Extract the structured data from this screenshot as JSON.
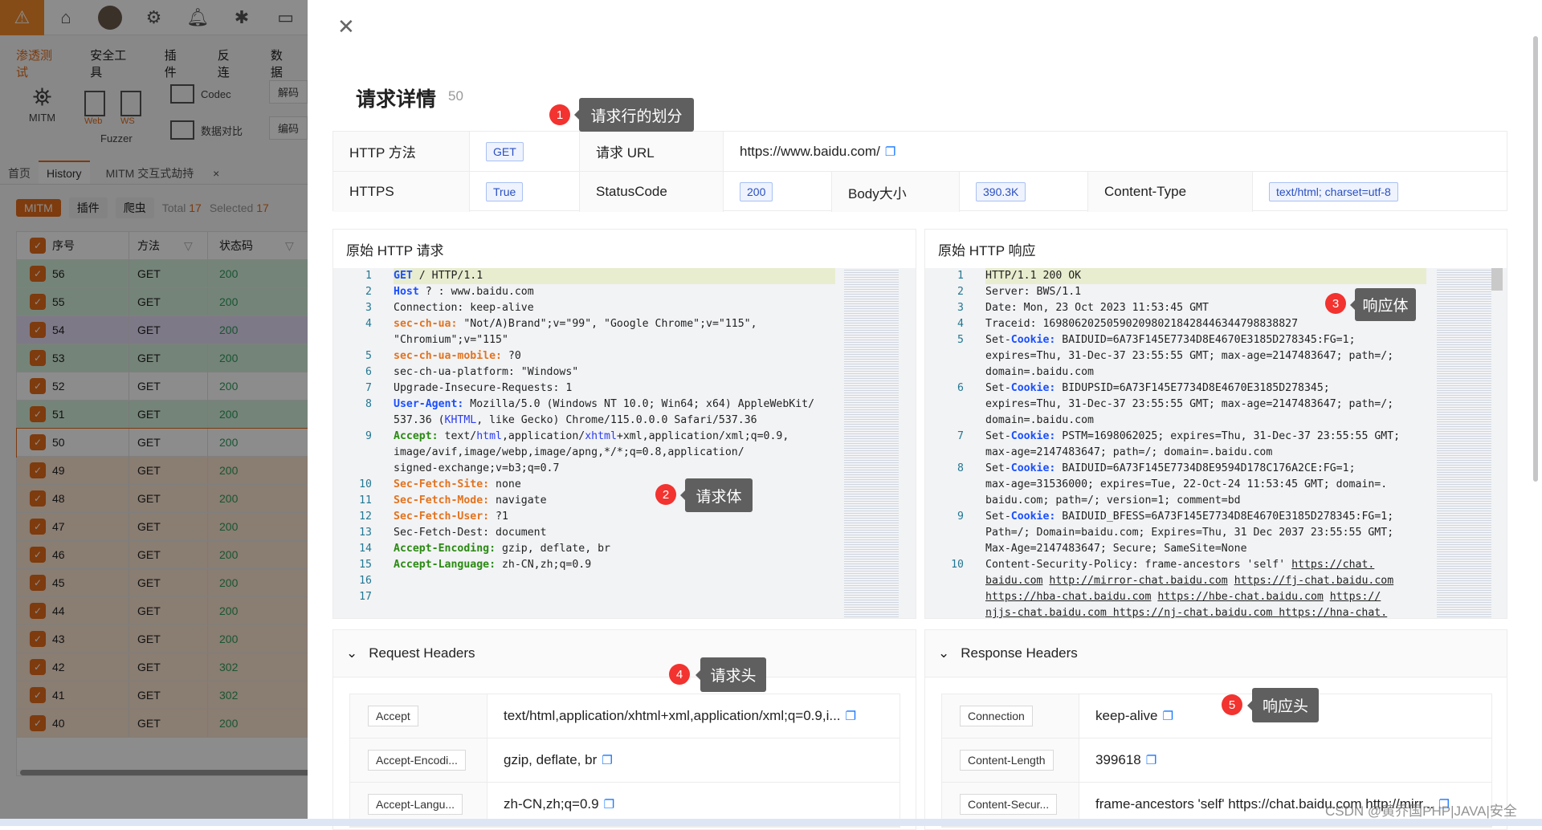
{
  "app": {
    "topbar_icons": [
      "warning-icon",
      "home-icon",
      "avatar",
      "gear-icon",
      "bell-icon",
      "bug-icon",
      "terminal-icon"
    ],
    "menu": [
      "渗透测试",
      "安全工具",
      "插件",
      "反连",
      "数据"
    ],
    "tools": {
      "mitm": "MITM",
      "fuzzer": "Fuzzer",
      "web": "Web",
      "ws": "WS",
      "codec": "Codec",
      "compare": "数据对比",
      "decode": "解码",
      "encode": "编码"
    },
    "tabs": [
      "首页",
      "History",
      "MITM 交互式劫持"
    ],
    "filters": {
      "mitm": "MITM",
      "plugin": "插件",
      "crawler": "爬虫",
      "total_label": "Total",
      "total": "17",
      "selected_label": "Selected",
      "selected": "17"
    },
    "table": {
      "headers": [
        "序号",
        "方法",
        "状态码"
      ],
      "rows": [
        {
          "id": "56",
          "method": "GET",
          "status": "200",
          "color": "green"
        },
        {
          "id": "55",
          "method": "GET",
          "status": "200",
          "color": "green"
        },
        {
          "id": "54",
          "method": "GET",
          "status": "200",
          "color": "purple"
        },
        {
          "id": "53",
          "method": "GET",
          "status": "200",
          "color": "green"
        },
        {
          "id": "52",
          "method": "GET",
          "status": "200",
          "color": "white"
        },
        {
          "id": "51",
          "method": "GET",
          "status": "200",
          "color": "green"
        },
        {
          "id": "50",
          "method": "GET",
          "status": "200",
          "color": "white",
          "selected": true
        },
        {
          "id": "49",
          "method": "GET",
          "status": "200",
          "color": "orange"
        },
        {
          "id": "48",
          "method": "GET",
          "status": "200",
          "color": "orange"
        },
        {
          "id": "47",
          "method": "GET",
          "status": "200",
          "color": "orange"
        },
        {
          "id": "46",
          "method": "GET",
          "status": "200",
          "color": "orange"
        },
        {
          "id": "45",
          "method": "GET",
          "status": "200",
          "color": "orange"
        },
        {
          "id": "44",
          "method": "GET",
          "status": "200",
          "color": "orange"
        },
        {
          "id": "43",
          "method": "GET",
          "status": "200",
          "color": "orange"
        },
        {
          "id": "42",
          "method": "GET",
          "status": "302",
          "color": "orange"
        },
        {
          "id": "41",
          "method": "GET",
          "status": "302",
          "color": "orange"
        },
        {
          "id": "40",
          "method": "GET",
          "status": "200",
          "color": "orange"
        }
      ]
    }
  },
  "drawer": {
    "title": "请求详情",
    "id": "50",
    "info": {
      "method_label": "HTTP 方法",
      "method": "GET",
      "url_label": "请求 URL",
      "url": "https://www.baidu.com/",
      "https_label": "HTTPS",
      "https": "True",
      "status_label": "StatusCode",
      "status": "200",
      "body_label": "Body大小",
      "body": "390.3K",
      "ctype_label": "Content-Type",
      "ctype": "text/html; charset=utf-8"
    },
    "raw_request_title": "原始 HTTP 请求",
    "raw_response_title": "原始 HTTP 响应",
    "raw_request": [
      {
        "n": "1",
        "s": [
          [
            "GET",
            "kb"
          ],
          [
            " / HTTP/1.1",
            ""
          ]
        ],
        "hl": true
      },
      {
        "n": "2",
        "s": [
          [
            "Host",
            "kb"
          ],
          [
            " ? ",
            ""
          ],
          [
            ": www.baidu.com",
            ""
          ]
        ]
      },
      {
        "n": "3",
        "s": [
          [
            "Connection: keep-alive",
            ""
          ]
        ]
      },
      {
        "n": "4",
        "s": [
          [
            "sec-ch-ua:",
            "ko"
          ],
          [
            " \"Not/A)Brand\";v=\"99\", \"Google Chrome\";v=\"115\", ",
            ""
          ]
        ]
      },
      {
        "n": "",
        "s": [
          [
            "\"Chromium\";v=\"115\"",
            ""
          ]
        ]
      },
      {
        "n": "5",
        "s": [
          [
            "sec-ch-ua-mobile:",
            "ko"
          ],
          [
            " ?0",
            ""
          ]
        ]
      },
      {
        "n": "6",
        "s": [
          [
            "sec-ch-ua-platform: \"Windows\"",
            ""
          ]
        ]
      },
      {
        "n": "7",
        "s": [
          [
            "Upgrade-Insecure-Requests: 1",
            ""
          ]
        ]
      },
      {
        "n": "8",
        "s": [
          [
            "User-Agent:",
            "kb"
          ],
          [
            " Mozilla/5.0 (Windows NT 10.0; Win64; x64) AppleWebKit/",
            ""
          ]
        ]
      },
      {
        "n": "",
        "s": [
          [
            "537.36 (",
            ""
          ],
          [
            "KHTML",
            "kl"
          ],
          [
            ", like Gecko) Chrome/115.0.0.0 Safari/537.36",
            ""
          ]
        ]
      },
      {
        "n": "9",
        "s": [
          [
            "Accept:",
            "kg"
          ],
          [
            " text/",
            ""
          ],
          [
            "html",
            "kl"
          ],
          [
            ",application/",
            ""
          ],
          [
            "xhtml",
            "kl"
          ],
          [
            "+xml,application/xml;q=0.9,",
            ""
          ]
        ]
      },
      {
        "n": "",
        "s": [
          [
            "image/avif,image/webp,image/apng,*/*;q=0.8,application/",
            ""
          ]
        ]
      },
      {
        "n": "",
        "s": [
          [
            "signed-exchange;v=b3;q=0.7",
            ""
          ]
        ]
      },
      {
        "n": "10",
        "s": [
          [
            "Sec-Fetch-Site:",
            "ko"
          ],
          [
            " none",
            ""
          ]
        ]
      },
      {
        "n": "11",
        "s": [
          [
            "Sec-Fetch-Mode:",
            "ko"
          ],
          [
            " navigate",
            ""
          ]
        ]
      },
      {
        "n": "12",
        "s": [
          [
            "Sec-Fetch-User:",
            "ko"
          ],
          [
            " ?1",
            ""
          ]
        ]
      },
      {
        "n": "13",
        "s": [
          [
            "Sec-Fetch-Dest: document",
            ""
          ]
        ]
      },
      {
        "n": "14",
        "s": [
          [
            "Accept-Encoding:",
            "kg"
          ],
          [
            " gzip, deflate, br",
            ""
          ]
        ]
      },
      {
        "n": "15",
        "s": [
          [
            "Accept-Language:",
            "kg"
          ],
          [
            " zh-CN,zh;q=0.9",
            ""
          ]
        ]
      },
      {
        "n": "16",
        "s": []
      },
      {
        "n": "17",
        "s": []
      }
    ],
    "raw_response": [
      {
        "n": "1",
        "s": [
          [
            "HTTP/1.1 200 OK",
            ""
          ]
        ],
        "hl": true
      },
      {
        "n": "2",
        "s": [
          [
            "Server: BWS/1.1",
            ""
          ]
        ]
      },
      {
        "n": "3",
        "s": [
          [
            "Date: Mon, 23 Oct 2023 11:53:45 GMT",
            ""
          ]
        ]
      },
      {
        "n": "4",
        "s": [
          [
            "Traceid: 1698062025059020980218428446344798838827",
            ""
          ]
        ]
      },
      {
        "n": "5",
        "s": [
          [
            "Set-",
            ""
          ],
          [
            "Cookie:",
            "kb"
          ],
          [
            " BAIDUID=6A73F145E7734D8E4670E3185D278345:FG=1; ",
            ""
          ]
        ]
      },
      {
        "n": "",
        "s": [
          [
            "expires=Thu, 31-Dec-37 23:55:55 GMT; max-age=2147483647; path=/; ",
            ""
          ]
        ]
      },
      {
        "n": "",
        "s": [
          [
            "domain=.baidu.com",
            ""
          ]
        ]
      },
      {
        "n": "6",
        "s": [
          [
            "Set-",
            ""
          ],
          [
            "Cookie:",
            "kb"
          ],
          [
            " BIDUPSID=6A73F145E7734D8E4670E3185D278345; ",
            ""
          ]
        ]
      },
      {
        "n": "",
        "s": [
          [
            "expires=Thu, 31-Dec-37 23:55:55 GMT; max-age=2147483647; path=/; ",
            ""
          ]
        ]
      },
      {
        "n": "",
        "s": [
          [
            "domain=.baidu.com",
            ""
          ]
        ]
      },
      {
        "n": "7",
        "s": [
          [
            "Set-",
            ""
          ],
          [
            "Cookie:",
            "kb"
          ],
          [
            " PSTM=1698062025; expires=Thu, 31-Dec-37 23:55:55 GMT; ",
            ""
          ]
        ]
      },
      {
        "n": "",
        "s": [
          [
            "max-age=2147483647; path=/; domain=.baidu.com",
            ""
          ]
        ]
      },
      {
        "n": "8",
        "s": [
          [
            "Set-",
            ""
          ],
          [
            "Cookie:",
            "kb"
          ],
          [
            " BAIDUID=6A73F145E7734D8E9594D178C176A2CE:FG=1; ",
            ""
          ]
        ]
      },
      {
        "n": "",
        "s": [
          [
            "max-age=31536000; expires=Tue, 22-Oct-24 11:53:45 GMT; domain=.",
            ""
          ]
        ]
      },
      {
        "n": "",
        "s": [
          [
            "baidu.com; path=/; version=1; comment=bd",
            ""
          ]
        ]
      },
      {
        "n": "9",
        "s": [
          [
            "Set-",
            ""
          ],
          [
            "Cookie:",
            "kb"
          ],
          [
            " BAIDUID_BFESS=6A73F145E7734D8E4670E3185D278345:FG=1; ",
            ""
          ]
        ]
      },
      {
        "n": "",
        "s": [
          [
            "Path=/; Domain=baidu.com; Expires=Thu, 31 Dec 2037 23:55:55 GMT; ",
            ""
          ]
        ]
      },
      {
        "n": "",
        "s": [
          [
            "Max-Age=2147483647; Secure; SameSite=None",
            ""
          ]
        ]
      },
      {
        "n": "10",
        "s": [
          [
            "Content-Security-Policy: frame-ancestors 'self' ",
            ""
          ],
          [
            "https://chat.",
            "u"
          ]
        ]
      },
      {
        "n": "",
        "s": [
          [
            "baidu.com",
            "u"
          ],
          [
            " ",
            ""
          ],
          [
            "http://mirror-chat.baidu.com",
            "u"
          ],
          [
            " ",
            ""
          ],
          [
            "https://fj-chat.baidu.com",
            "u"
          ]
        ]
      },
      {
        "n": "",
        "s": [
          [
            "https://hba-chat.baidu.com",
            "u"
          ],
          [
            " ",
            ""
          ],
          [
            "https://hbe-chat.baidu.com",
            "u"
          ],
          [
            " ",
            ""
          ],
          [
            "https://",
            "u"
          ]
        ]
      },
      {
        "n": "",
        "s": [
          [
            "njjs-chat.baidu.com https://nj-chat.baidu.com https://hna-chat.",
            "u"
          ]
        ]
      }
    ],
    "request_headers_title": "Request Headers",
    "response_headers_title": "Response Headers",
    "request_headers": [
      {
        "key": "Accept",
        "value": "text/html,application/xhtml+xml,application/xml;q=0.9,i..."
      },
      {
        "key": "Accept-Encodi...",
        "value": "gzip, deflate, br"
      },
      {
        "key": "Accept-Langu...",
        "value": "zh-CN,zh;q=0.9"
      }
    ],
    "response_headers": [
      {
        "key": "Connection",
        "value": "keep-alive"
      },
      {
        "key": "Content-Length",
        "value": "399618"
      },
      {
        "key": "Content-Secur...",
        "value": "frame-ancestors 'self' https://chat.baidu.com http://mirr..."
      }
    ]
  },
  "annotations": [
    {
      "num": "1",
      "text": "请求行的划分"
    },
    {
      "num": "2",
      "text": "请求体"
    },
    {
      "num": "3",
      "text": "响应体"
    },
    {
      "num": "4",
      "text": "请求头"
    },
    {
      "num": "5",
      "text": "响应头"
    }
  ],
  "watermark": "CSDN @黄乔国PHP|JAVA|安全",
  "colors": {
    "accent": "#e36c1b",
    "tag_blue": "#2b4fc0",
    "copy_icon": "#1677ff",
    "annotation_red": "#f2332f"
  }
}
